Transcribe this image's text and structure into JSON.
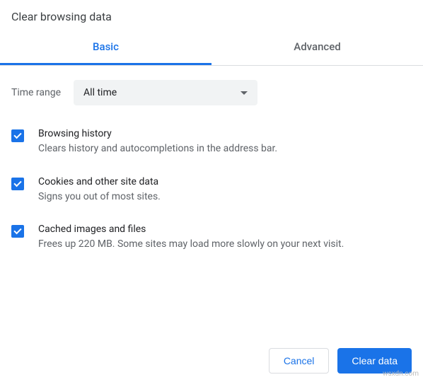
{
  "dialog": {
    "title": "Clear browsing data"
  },
  "tabs": {
    "basic": "Basic",
    "advanced": "Advanced"
  },
  "timerange": {
    "label": "Time range",
    "value": "All time"
  },
  "options": [
    {
      "title": "Browsing history",
      "desc": "Clears history and autocompletions in the address bar."
    },
    {
      "title": "Cookies and other site data",
      "desc": "Signs you out of most sites."
    },
    {
      "title": "Cached images and files",
      "desc": "Frees up 220 MB. Some sites may load more slowly on your next visit."
    }
  ],
  "buttons": {
    "cancel": "Cancel",
    "clear": "Clear data"
  },
  "watermark": "wsxdn.com"
}
